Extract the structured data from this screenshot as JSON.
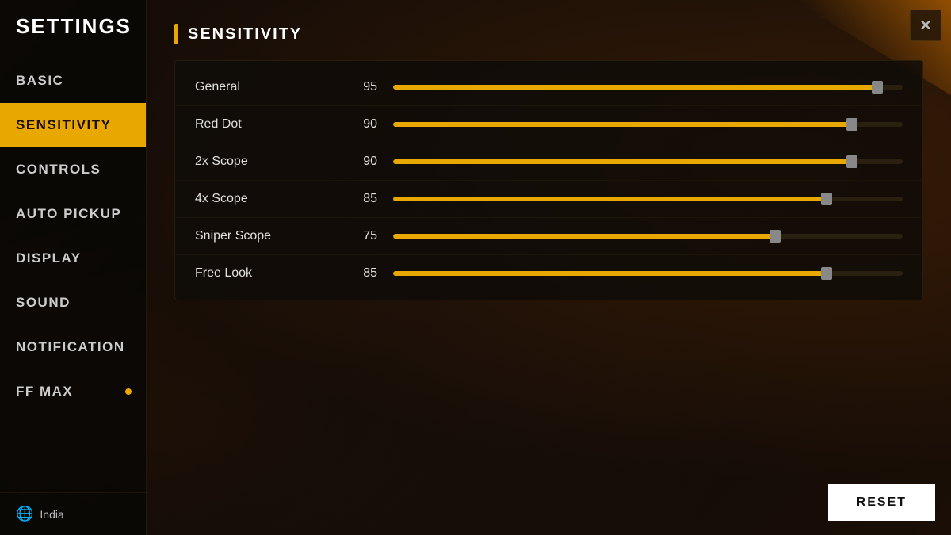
{
  "app": {
    "title": "SETTINGS"
  },
  "sidebar": {
    "items": [
      {
        "id": "basic",
        "label": "BASIC",
        "active": false,
        "notification": false
      },
      {
        "id": "sensitivity",
        "label": "SENSITIVITY",
        "active": true,
        "notification": false
      },
      {
        "id": "controls",
        "label": "CONTROLS",
        "active": false,
        "notification": false
      },
      {
        "id": "auto-pickup",
        "label": "AUTO PICKUP",
        "active": false,
        "notification": false
      },
      {
        "id": "display",
        "label": "DISPLAY",
        "active": false,
        "notification": false
      },
      {
        "id": "sound",
        "label": "SOUND",
        "active": false,
        "notification": false
      },
      {
        "id": "notification",
        "label": "NOTIFICATION",
        "active": false,
        "notification": false
      },
      {
        "id": "ff-max",
        "label": "FF MAX",
        "active": false,
        "notification": true
      }
    ],
    "footer": {
      "region": "India"
    }
  },
  "main": {
    "section_title": "SENSITIVITY",
    "settings": [
      {
        "label": "General",
        "value": 95,
        "pct": 95
      },
      {
        "label": "Red Dot",
        "value": 90,
        "pct": 90
      },
      {
        "label": "2x Scope",
        "value": 90,
        "pct": 90
      },
      {
        "label": "4x Scope",
        "value": 85,
        "pct": 85
      },
      {
        "label": "Sniper Scope",
        "value": 75,
        "pct": 75
      },
      {
        "label": "Free Look",
        "value": 85,
        "pct": 85
      }
    ]
  },
  "buttons": {
    "reset": "RESET",
    "close": "✕"
  }
}
